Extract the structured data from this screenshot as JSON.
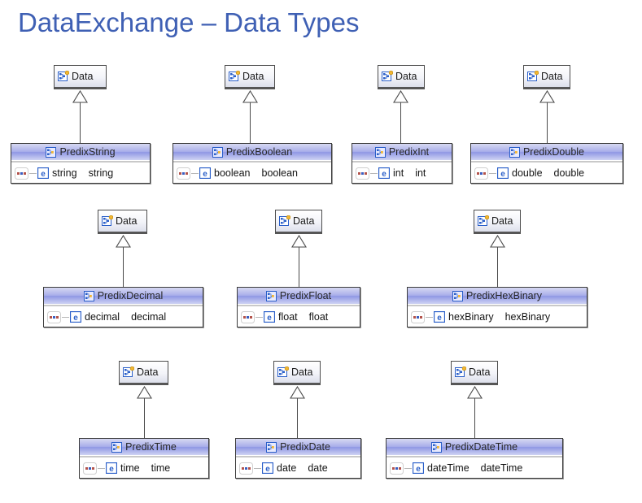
{
  "slide": {
    "title": "DataExchange – Data Types",
    "title_color": "#3f60b4"
  },
  "diagram": {
    "type": "uml-class-diagram",
    "parent_label": "Data",
    "relationship": "generalization",
    "icons": {
      "data_box": "xsd-element-icon",
      "class_header": "xsd-complex-type-icon",
      "attribute_sequence": "xsd-sequence-icon",
      "attribute_element": "xsd-element-e-icon"
    },
    "classes": [
      {
        "name": "PredixString",
        "parent": "Data",
        "attribute": "string",
        "type": "string"
      },
      {
        "name": "PredixBoolean",
        "parent": "Data",
        "attribute": "boolean",
        "type": "boolean"
      },
      {
        "name": "PredixInt",
        "parent": "Data",
        "attribute": "int",
        "type": "int"
      },
      {
        "name": "PredixDouble",
        "parent": "Data",
        "attribute": "double",
        "type": "double"
      },
      {
        "name": "PredixDecimal",
        "parent": "Data",
        "attribute": "decimal",
        "type": "decimal"
      },
      {
        "name": "PredixFloat",
        "parent": "Data",
        "attribute": "float",
        "type": "float"
      },
      {
        "name": "PredixHexBinary",
        "parent": "Data",
        "attribute": "hexBinary",
        "type": "hexBinary"
      },
      {
        "name": "PredixTime",
        "parent": "Data",
        "attribute": "time",
        "type": "time"
      },
      {
        "name": "PredixDate",
        "parent": "Data",
        "attribute": "date",
        "type": "date"
      },
      {
        "name": "PredixDateTime",
        "parent": "Data",
        "attribute": "dateTime",
        "type": "dateTime"
      }
    ],
    "colors": {
      "class_header_gradient_top": "#d7d9f2",
      "class_header_gradient_mid": "#8f97e4",
      "box_border": "#3c3c3c",
      "connector": "#4a4a4a",
      "element_icon_blue": "#2a5fc9",
      "data_icon_yellow": "#f2b632"
    }
  }
}
